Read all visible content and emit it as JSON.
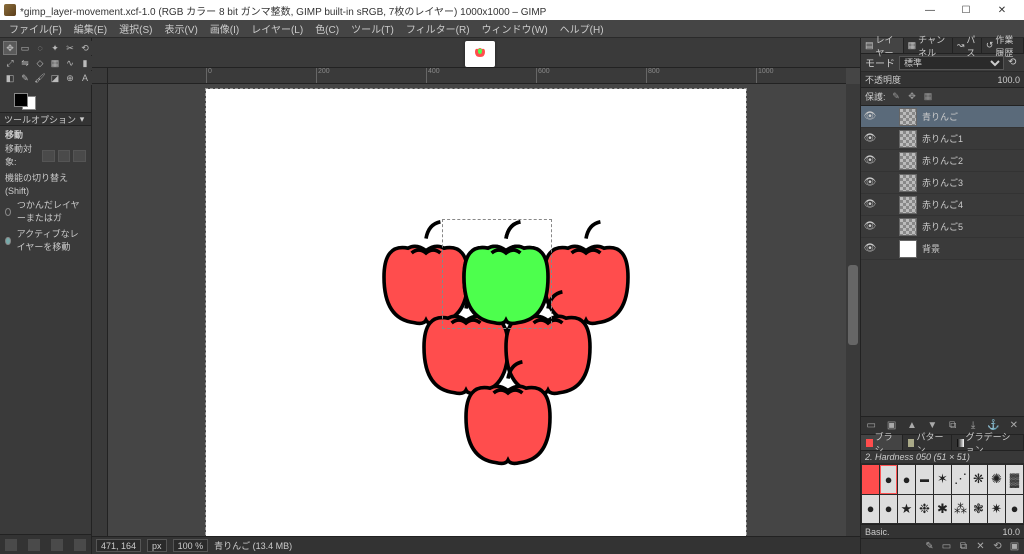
{
  "window": {
    "title": "*gimp_layer-movement.xcf-1.0 (RGB カラー 8 bit ガンマ整数, GIMP built-in sRGB, 7枚のレイヤー) 1000x1000 – GIMP"
  },
  "menubar": {
    "file": "ファイル(F)",
    "edit": "編集(E)",
    "select": "選択(S)",
    "view": "表示(V)",
    "image": "画像(I)",
    "layer": "レイヤー(L)",
    "colors": "色(C)",
    "tools": "ツール(T)",
    "filters": "フィルター(R)",
    "windows": "ウィンドウ(W)",
    "help": "ヘルプ(H)"
  },
  "tool_options": {
    "header": "ツールオプション",
    "tool_name": "移動",
    "target_label": "移動対象:",
    "toggle_label": "機能の切り替え (Shift)",
    "radio1": "つかんだレイヤーまたはガ",
    "radio2": "アクティブなレイヤーを移動"
  },
  "statusbar": {
    "coords": "471, 164",
    "unit": "px",
    "zoom": "100 %",
    "layer_info": "青りんご (13.4 MB)"
  },
  "right": {
    "tabs": {
      "layers": "レイヤー",
      "channels": "チャンネル",
      "paths": "パス",
      "history": "作業履歴"
    },
    "mode_label": "モード",
    "mode_value": "標準",
    "opacity_label": "不透明度",
    "opacity_value": "100.0",
    "lock_label": "保護:"
  },
  "layers": [
    {
      "name": "青りんご",
      "active": true,
      "visible": true,
      "white": false
    },
    {
      "name": "赤りんご1",
      "active": false,
      "visible": true,
      "white": false
    },
    {
      "name": "赤りんご2",
      "active": false,
      "visible": true,
      "white": false
    },
    {
      "name": "赤りんご3",
      "active": false,
      "visible": true,
      "white": false
    },
    {
      "name": "赤りんご4",
      "active": false,
      "visible": true,
      "white": false
    },
    {
      "name": "赤りんご5",
      "active": false,
      "visible": true,
      "white": false
    },
    {
      "name": "背景",
      "active": false,
      "visible": true,
      "white": true
    }
  ],
  "brush": {
    "tabs": {
      "brushes": "ブラシ",
      "patterns": "パターン",
      "gradients": "グラデーション"
    },
    "selected_label": "2. Hardness 050 (51 × 51)",
    "footer_left": "Basic.",
    "spacing": "10.0"
  }
}
